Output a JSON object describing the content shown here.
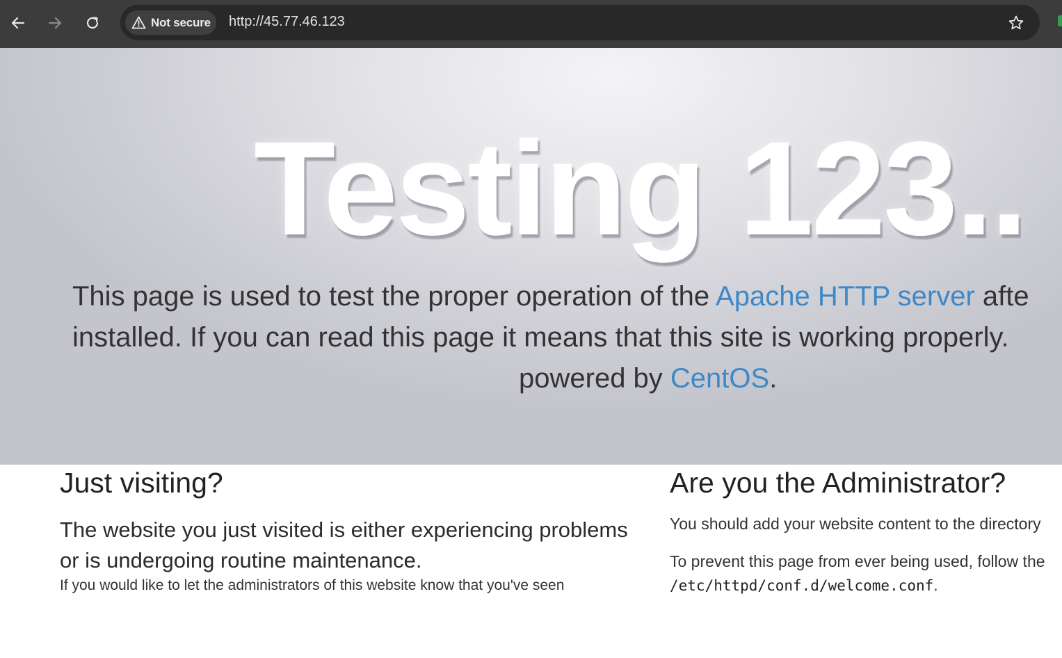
{
  "browser": {
    "security_label": "Not secure",
    "url": "http://45.77.46.123",
    "icons": {
      "back": "back-arrow-icon",
      "forward": "forward-arrow-icon",
      "reload": "reload-icon",
      "warning": "warning-triangle-icon",
      "bookmark": "star-icon"
    }
  },
  "hero": {
    "title": "Testing 123..",
    "line1_prefix": "This page is used to test the proper operation of the ",
    "line1_link": "Apache HTTP server",
    "line1_suffix": " afte",
    "line2": "installed. If you can read this page it means that this site is working properly.",
    "line3_prefix": "powered by ",
    "line3_link": "CentOS",
    "line3_suffix": "."
  },
  "visiting": {
    "heading": "Just visiting?",
    "lead": "The website you just visited is either experiencing problems or is undergoing routine maintenance.",
    "note": "If you would like to let the administrators of this website know that you've seen"
  },
  "admin": {
    "heading": "Are you the Administrator?",
    "p1": "You should add your website content to the directory",
    "p2_prefix": "To prevent this page from ever being used, follow the",
    "p2_code": "/etc/httpd/conf.d/welcome.conf",
    "p2_suffix": "."
  },
  "colors": {
    "toolbar_bg": "#3c3c3c",
    "omnibox_bg": "#282828",
    "link": "#3f88c7",
    "hero_text": "#333333"
  }
}
